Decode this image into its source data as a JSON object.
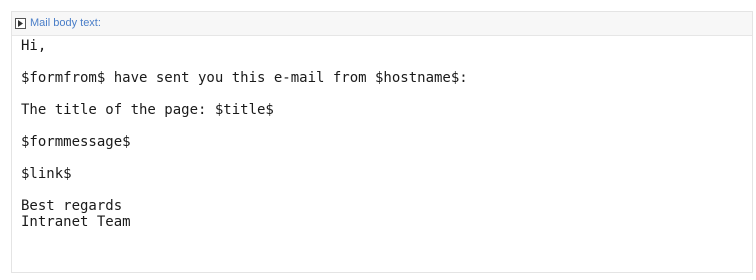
{
  "header": {
    "label": "Mail body text:",
    "toggle_icon": "triangle-right-icon"
  },
  "body": {
    "greeting": "Hi,",
    "line_sender": "$formfrom$ have sent you this e-mail from $hostname$:",
    "line_title": "The title of the page: $title$",
    "line_message": "$formmessage$",
    "line_link": "$link$",
    "closing_1": "Best regards",
    "closing_2": "Intranet Team"
  }
}
